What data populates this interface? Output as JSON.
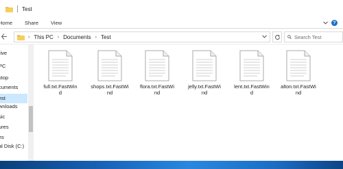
{
  "window": {
    "title": "Test"
  },
  "ribbon": {
    "tabs": [
      "Home",
      "Share",
      "View"
    ]
  },
  "address": {
    "crumbs": [
      "This PC",
      "Documents",
      "Test"
    ],
    "search_placeholder": "Search Test"
  },
  "nav": {
    "items": [
      {
        "label": "rive",
        "selected": false
      },
      {
        "label": "PC",
        "selected": false
      },
      {
        "label": "ktop",
        "selected": false
      },
      {
        "label": "cuments",
        "selected": false
      },
      {
        "label": "est",
        "selected": true
      },
      {
        "label": "wnloads",
        "selected": false
      },
      {
        "label": "sic",
        "selected": false
      },
      {
        "label": "ures",
        "selected": false
      },
      {
        "label": "es",
        "selected": false
      },
      {
        "label": "al Disk (C:)",
        "selected": false
      }
    ]
  },
  "files": [
    {
      "name_line1": "full.txt.FastWin",
      "name_line2": "d",
      "icon": "text-document-icon"
    },
    {
      "name_line1": "shops.txt.FastWi",
      "name_line2": "nd",
      "icon": "text-document-icon"
    },
    {
      "name_line1": "flora.txt.FastWi",
      "name_line2": "nd",
      "icon": "text-document-icon"
    },
    {
      "name_line1": "jelly.txt.FastWi",
      "name_line2": "nd",
      "icon": "text-document-icon"
    },
    {
      "name_line1": "lent.txt.FastWin",
      "name_line2": "d",
      "icon": "text-document-icon"
    },
    {
      "name_line1": "alton.txt.FastWi",
      "name_line2": "nd",
      "icon": "text-document-icon"
    }
  ],
  "colors": {
    "folder": "#e8b940",
    "selection": "#cce8ff",
    "help": "#1f6fc6",
    "taskbar": "#1763b8"
  }
}
